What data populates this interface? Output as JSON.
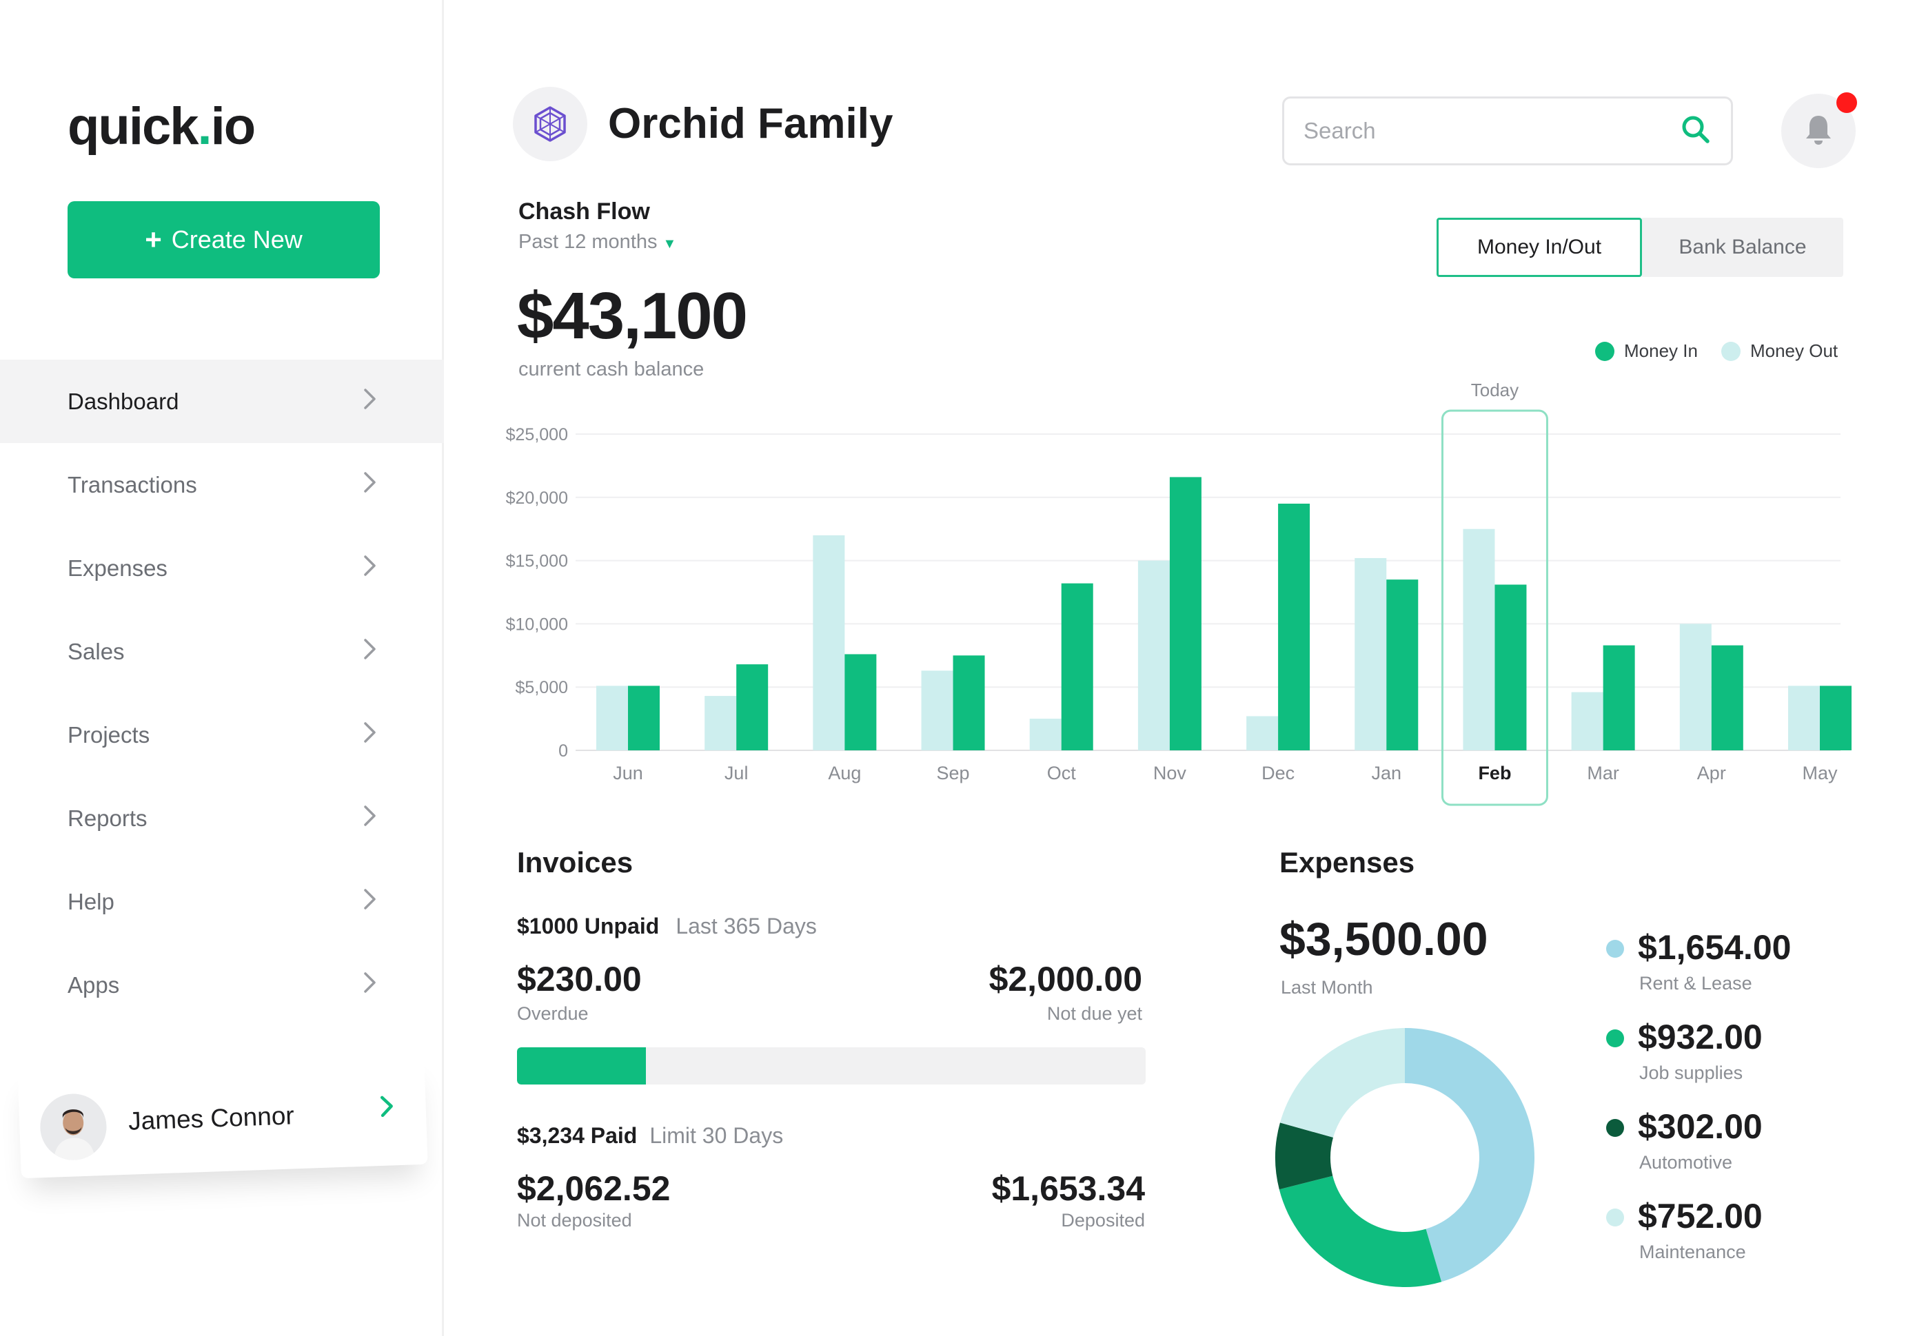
{
  "app": {
    "logo_main": "quick",
    "logo_dot": ".",
    "logo_tld": "io"
  },
  "sidebar": {
    "create_label": "Create New",
    "create_plus": "+",
    "items": [
      {
        "label": "Dashboard",
        "active": true
      },
      {
        "label": "Transactions"
      },
      {
        "label": "Expenses"
      },
      {
        "label": "Sales"
      },
      {
        "label": "Projects"
      },
      {
        "label": "Reports"
      },
      {
        "label": "Help"
      },
      {
        "label": "Apps"
      }
    ],
    "user": {
      "name": "James Connor"
    }
  },
  "header": {
    "org_name": "Orchid Family",
    "search_placeholder": "Search"
  },
  "cashflow": {
    "title": "Chash Flow",
    "period": "Past 12 months",
    "amount": "$43,100",
    "amount_caption": "current cash balance",
    "toggle": [
      "Money In/Out",
      "Bank Balance"
    ],
    "legend_in": "Money In",
    "legend_out": "Money Out",
    "today_label": "Today"
  },
  "chart_data": {
    "type": "bar",
    "categories": [
      "Jun",
      "Jul",
      "Aug",
      "Sep",
      "Oct",
      "Nov",
      "Dec",
      "Jan",
      "Feb",
      "Mar",
      "Apr",
      "May"
    ],
    "series": [
      {
        "name": "Money Out",
        "color": "#cdeeee",
        "values": [
          5100,
          4300,
          17000,
          6300,
          2500,
          15000,
          2700,
          15200,
          17500,
          4600,
          10000,
          5100
        ]
      },
      {
        "name": "Money In",
        "color": "#0fbd7f",
        "values": [
          5100,
          6800,
          7600,
          7500,
          13200,
          21600,
          19500,
          13500,
          13100,
          8300,
          8300,
          5100
        ]
      }
    ],
    "y_ticks": [
      "0",
      "$5,000",
      "$10,000",
      "$15,000",
      "$20,000",
      "$25,000"
    ],
    "ylim": [
      0,
      25000
    ],
    "highlight": "Feb",
    "grid": true,
    "legend": "top-right"
  },
  "invoices": {
    "title": "Invoices",
    "unpaid_strong": "$1000 Unpaid",
    "unpaid_muted": "Last 365 Days",
    "overdue_amount": "$230.00",
    "overdue_label": "Overdue",
    "notdue_amount": "$2,000.00",
    "notdue_label": "Not due yet",
    "progress": 0.205,
    "paid_strong": "$3,234 Paid",
    "paid_muted": "Limit 30 Days",
    "notdeposited_amount": "$2,062.52",
    "notdeposited_label": "Not deposited",
    "deposited_amount": "$1,653.34",
    "deposited_label": "Deposited"
  },
  "expenses": {
    "title": "Expenses",
    "amount": "$3,500.00",
    "caption": "Last Month",
    "items": [
      {
        "value": "$1,654.00",
        "label": "Rent & Lease",
        "color": "#9fd8e8",
        "amount": 1654
      },
      {
        "value": "$932.00",
        "label": "Job supplies",
        "color": "#0fbd7f",
        "amount": 932
      },
      {
        "value": "$302.00",
        "label": "Automotive",
        "color": "#0b5b3c",
        "amount": 302
      },
      {
        "value": "$752.00",
        "label": "Maintenance",
        "color": "#cdeeee",
        "amount": 752
      }
    ]
  }
}
